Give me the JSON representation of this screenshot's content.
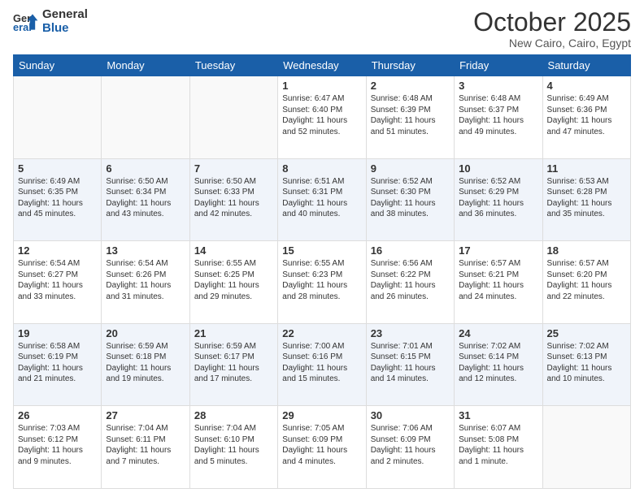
{
  "logo": {
    "line1": "General",
    "line2": "Blue"
  },
  "header": {
    "month": "October 2025",
    "location": "New Cairo, Cairo, Egypt"
  },
  "weekdays": [
    "Sunday",
    "Monday",
    "Tuesday",
    "Wednesday",
    "Thursday",
    "Friday",
    "Saturday"
  ],
  "weeks": [
    [
      {
        "day": "",
        "info": ""
      },
      {
        "day": "",
        "info": ""
      },
      {
        "day": "",
        "info": ""
      },
      {
        "day": "1",
        "info": "Sunrise: 6:47 AM\nSunset: 6:40 PM\nDaylight: 11 hours\nand 52 minutes."
      },
      {
        "day": "2",
        "info": "Sunrise: 6:48 AM\nSunset: 6:39 PM\nDaylight: 11 hours\nand 51 minutes."
      },
      {
        "day": "3",
        "info": "Sunrise: 6:48 AM\nSunset: 6:37 PM\nDaylight: 11 hours\nand 49 minutes."
      },
      {
        "day": "4",
        "info": "Sunrise: 6:49 AM\nSunset: 6:36 PM\nDaylight: 11 hours\nand 47 minutes."
      }
    ],
    [
      {
        "day": "5",
        "info": "Sunrise: 6:49 AM\nSunset: 6:35 PM\nDaylight: 11 hours\nand 45 minutes."
      },
      {
        "day": "6",
        "info": "Sunrise: 6:50 AM\nSunset: 6:34 PM\nDaylight: 11 hours\nand 43 minutes."
      },
      {
        "day": "7",
        "info": "Sunrise: 6:50 AM\nSunset: 6:33 PM\nDaylight: 11 hours\nand 42 minutes."
      },
      {
        "day": "8",
        "info": "Sunrise: 6:51 AM\nSunset: 6:31 PM\nDaylight: 11 hours\nand 40 minutes."
      },
      {
        "day": "9",
        "info": "Sunrise: 6:52 AM\nSunset: 6:30 PM\nDaylight: 11 hours\nand 38 minutes."
      },
      {
        "day": "10",
        "info": "Sunrise: 6:52 AM\nSunset: 6:29 PM\nDaylight: 11 hours\nand 36 minutes."
      },
      {
        "day": "11",
        "info": "Sunrise: 6:53 AM\nSunset: 6:28 PM\nDaylight: 11 hours\nand 35 minutes."
      }
    ],
    [
      {
        "day": "12",
        "info": "Sunrise: 6:54 AM\nSunset: 6:27 PM\nDaylight: 11 hours\nand 33 minutes."
      },
      {
        "day": "13",
        "info": "Sunrise: 6:54 AM\nSunset: 6:26 PM\nDaylight: 11 hours\nand 31 minutes."
      },
      {
        "day": "14",
        "info": "Sunrise: 6:55 AM\nSunset: 6:25 PM\nDaylight: 11 hours\nand 29 minutes."
      },
      {
        "day": "15",
        "info": "Sunrise: 6:55 AM\nSunset: 6:23 PM\nDaylight: 11 hours\nand 28 minutes."
      },
      {
        "day": "16",
        "info": "Sunrise: 6:56 AM\nSunset: 6:22 PM\nDaylight: 11 hours\nand 26 minutes."
      },
      {
        "day": "17",
        "info": "Sunrise: 6:57 AM\nSunset: 6:21 PM\nDaylight: 11 hours\nand 24 minutes."
      },
      {
        "day": "18",
        "info": "Sunrise: 6:57 AM\nSunset: 6:20 PM\nDaylight: 11 hours\nand 22 minutes."
      }
    ],
    [
      {
        "day": "19",
        "info": "Sunrise: 6:58 AM\nSunset: 6:19 PM\nDaylight: 11 hours\nand 21 minutes."
      },
      {
        "day": "20",
        "info": "Sunrise: 6:59 AM\nSunset: 6:18 PM\nDaylight: 11 hours\nand 19 minutes."
      },
      {
        "day": "21",
        "info": "Sunrise: 6:59 AM\nSunset: 6:17 PM\nDaylight: 11 hours\nand 17 minutes."
      },
      {
        "day": "22",
        "info": "Sunrise: 7:00 AM\nSunset: 6:16 PM\nDaylight: 11 hours\nand 15 minutes."
      },
      {
        "day": "23",
        "info": "Sunrise: 7:01 AM\nSunset: 6:15 PM\nDaylight: 11 hours\nand 14 minutes."
      },
      {
        "day": "24",
        "info": "Sunrise: 7:02 AM\nSunset: 6:14 PM\nDaylight: 11 hours\nand 12 minutes."
      },
      {
        "day": "25",
        "info": "Sunrise: 7:02 AM\nSunset: 6:13 PM\nDaylight: 11 hours\nand 10 minutes."
      }
    ],
    [
      {
        "day": "26",
        "info": "Sunrise: 7:03 AM\nSunset: 6:12 PM\nDaylight: 11 hours\nand 9 minutes."
      },
      {
        "day": "27",
        "info": "Sunrise: 7:04 AM\nSunset: 6:11 PM\nDaylight: 11 hours\nand 7 minutes."
      },
      {
        "day": "28",
        "info": "Sunrise: 7:04 AM\nSunset: 6:10 PM\nDaylight: 11 hours\nand 5 minutes."
      },
      {
        "day": "29",
        "info": "Sunrise: 7:05 AM\nSunset: 6:09 PM\nDaylight: 11 hours\nand 4 minutes."
      },
      {
        "day": "30",
        "info": "Sunrise: 7:06 AM\nSunset: 6:09 PM\nDaylight: 11 hours\nand 2 minutes."
      },
      {
        "day": "31",
        "info": "Sunrise: 6:07 AM\nSunset: 5:08 PM\nDaylight: 11 hours\nand 1 minute."
      },
      {
        "day": "",
        "info": ""
      }
    ]
  ]
}
